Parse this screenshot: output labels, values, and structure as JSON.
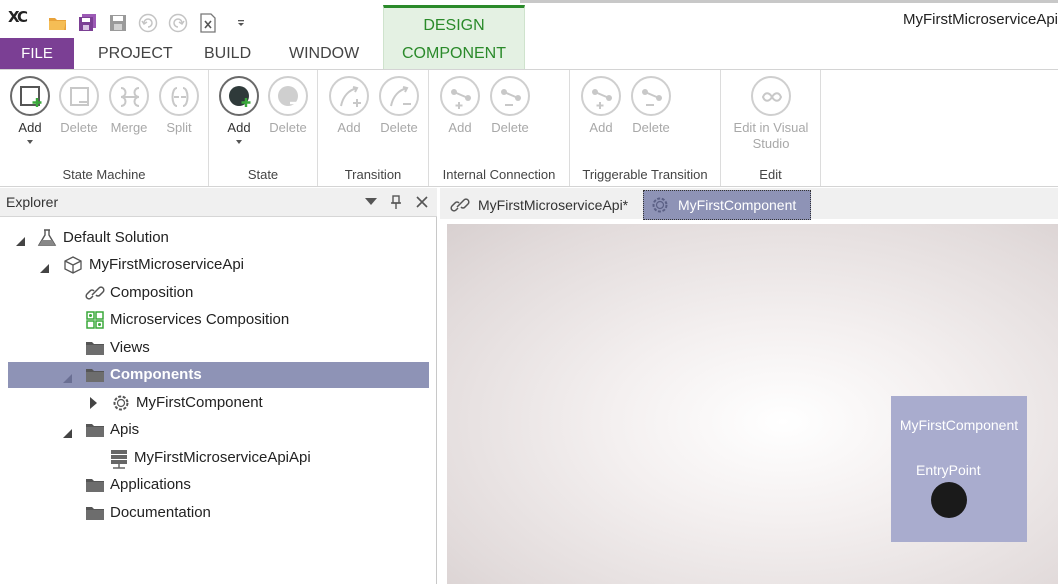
{
  "app": {
    "title": "MyFirstMicroserviceApi",
    "logo": "XC"
  },
  "quick_access": [
    "open-folder-icon",
    "save-all-icon",
    "save-icon",
    "undo-icon",
    "redo-icon",
    "close-file-icon",
    "customize-dropdown-icon"
  ],
  "context_tab": {
    "group": "DESIGN",
    "tab": "COMPONENT"
  },
  "menu": {
    "file": "FILE",
    "project": "PROJECT",
    "build": "BUILD",
    "window": "WINDOW"
  },
  "ribbon": {
    "state_machine": {
      "label": "State Machine",
      "add": "Add",
      "delete": "Delete",
      "merge": "Merge",
      "split": "Split"
    },
    "state": {
      "label": "State",
      "add": "Add",
      "delete": "Delete"
    },
    "transition": {
      "label": "Transition",
      "add": "Add",
      "delete": "Delete"
    },
    "internal_connection": {
      "label": "Internal Connection",
      "add": "Add",
      "delete": "Delete"
    },
    "triggerable_transition": {
      "label": "Triggerable Transition",
      "add": "Add",
      "delete": "Delete"
    },
    "edit": {
      "label": "Edit",
      "edit_in_vs_line1": "Edit in Visual",
      "edit_in_vs_line2": "Studio"
    }
  },
  "explorer": {
    "title": "Explorer",
    "tree": [
      {
        "label": "Default Solution"
      },
      {
        "label": "MyFirstMicroserviceApi"
      },
      {
        "label": "Composition"
      },
      {
        "label": "Microservices Composition"
      },
      {
        "label": "Views"
      },
      {
        "label": "Components"
      },
      {
        "label": "MyFirstComponent"
      },
      {
        "label": "Apis"
      },
      {
        "label": "MyFirstMicroserviceApiApi"
      },
      {
        "label": "Applications"
      },
      {
        "label": "Documentation"
      }
    ]
  },
  "doc_tabs": [
    {
      "label": "MyFirstMicroserviceApi*"
    },
    {
      "label": "MyFirstComponent"
    }
  ],
  "canvas": {
    "component_title": "MyFirstComponent",
    "entry_point_label": "EntryPoint"
  },
  "colors": {
    "file_menu": "#7b3f94",
    "design_accent": "#2a8a2a",
    "selection": "#8e93b6",
    "component_box": "#a9acce"
  }
}
